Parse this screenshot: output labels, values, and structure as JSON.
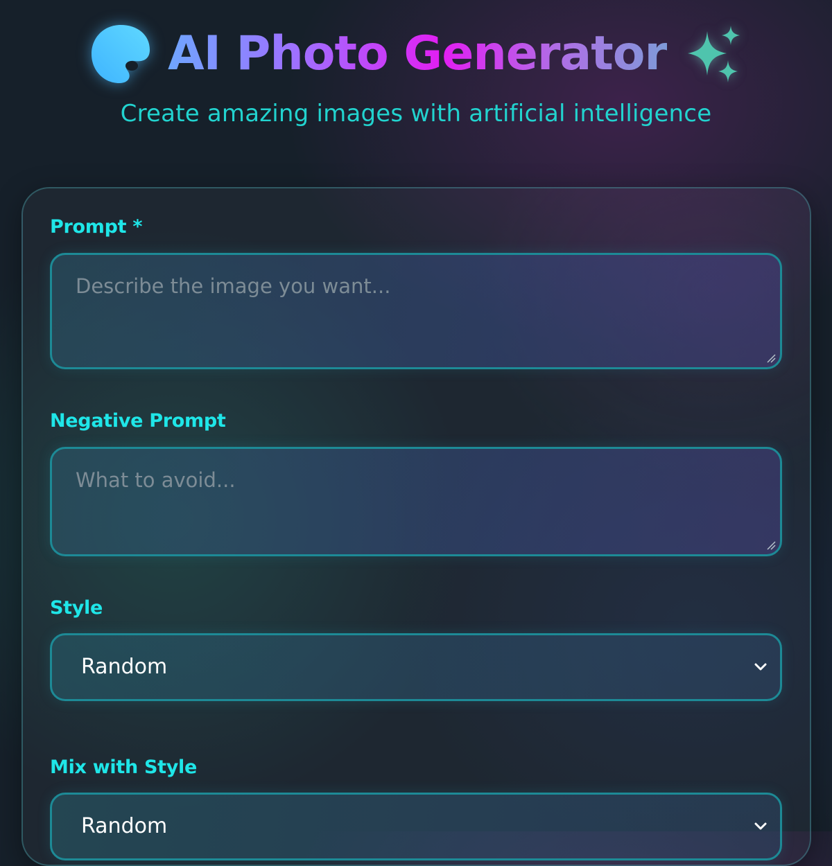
{
  "header": {
    "title": "AI Photo Generator",
    "subtitle": "Create amazing images with artificial intelligence",
    "left_icon": "palette-icon",
    "right_icon": "sparkles-icon"
  },
  "form": {
    "prompt": {
      "label": "Prompt *",
      "placeholder": "Describe the image you want...",
      "value": ""
    },
    "negative_prompt": {
      "label": "Negative Prompt",
      "placeholder": "What to avoid...",
      "value": ""
    },
    "style": {
      "label": "Style",
      "selected": "Random"
    },
    "mix_with_style": {
      "label": "Mix with Style",
      "selected": "Random"
    }
  },
  "colors": {
    "accent_cyan": "#1fe6e8",
    "subtitle_teal": "#22d3cf",
    "title_gradient": [
      "#6fa6ff",
      "#a36bff",
      "#e21ef2",
      "#7e9bd8"
    ],
    "field_border": "#1d8a96",
    "background": "#16202a"
  }
}
